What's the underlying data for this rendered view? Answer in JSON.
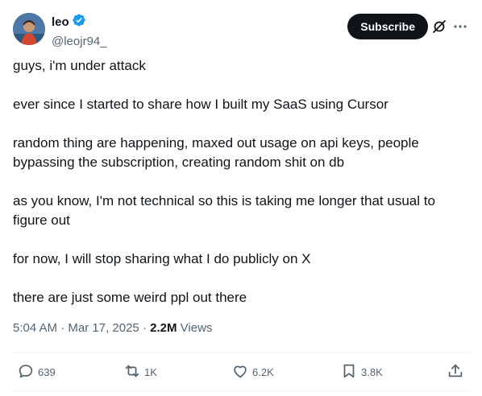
{
  "author": {
    "display_name": "leo",
    "handle": "@leojr94_",
    "verified": true,
    "verified_color": "#1d9bf0"
  },
  "header": {
    "subscribe_label": "Subscribe"
  },
  "tweet": {
    "paragraphs": [
      "guys, i'm under attack",
      "ever since I started to share how I built my SaaS using Cursor",
      "random thing are happening, maxed out usage on api keys, people bypassing the subscription, creating random shit on db",
      "as you know, I'm not technical so this is taking me longer that usual to figure out",
      "for now, I will stop sharing what I do publicly on X",
      "there are just some weird ppl out there"
    ],
    "time": "5:04 AM",
    "date": "Mar 17, 2025",
    "views_count": "2.2M",
    "views_label": "Views"
  },
  "actions": {
    "replies": "639",
    "reposts": "1K",
    "likes": "6.2K",
    "bookmarks": "3.8K"
  },
  "colors": {
    "text": "#0f1419",
    "secondary": "#536471",
    "divider": "#eff3f4"
  }
}
